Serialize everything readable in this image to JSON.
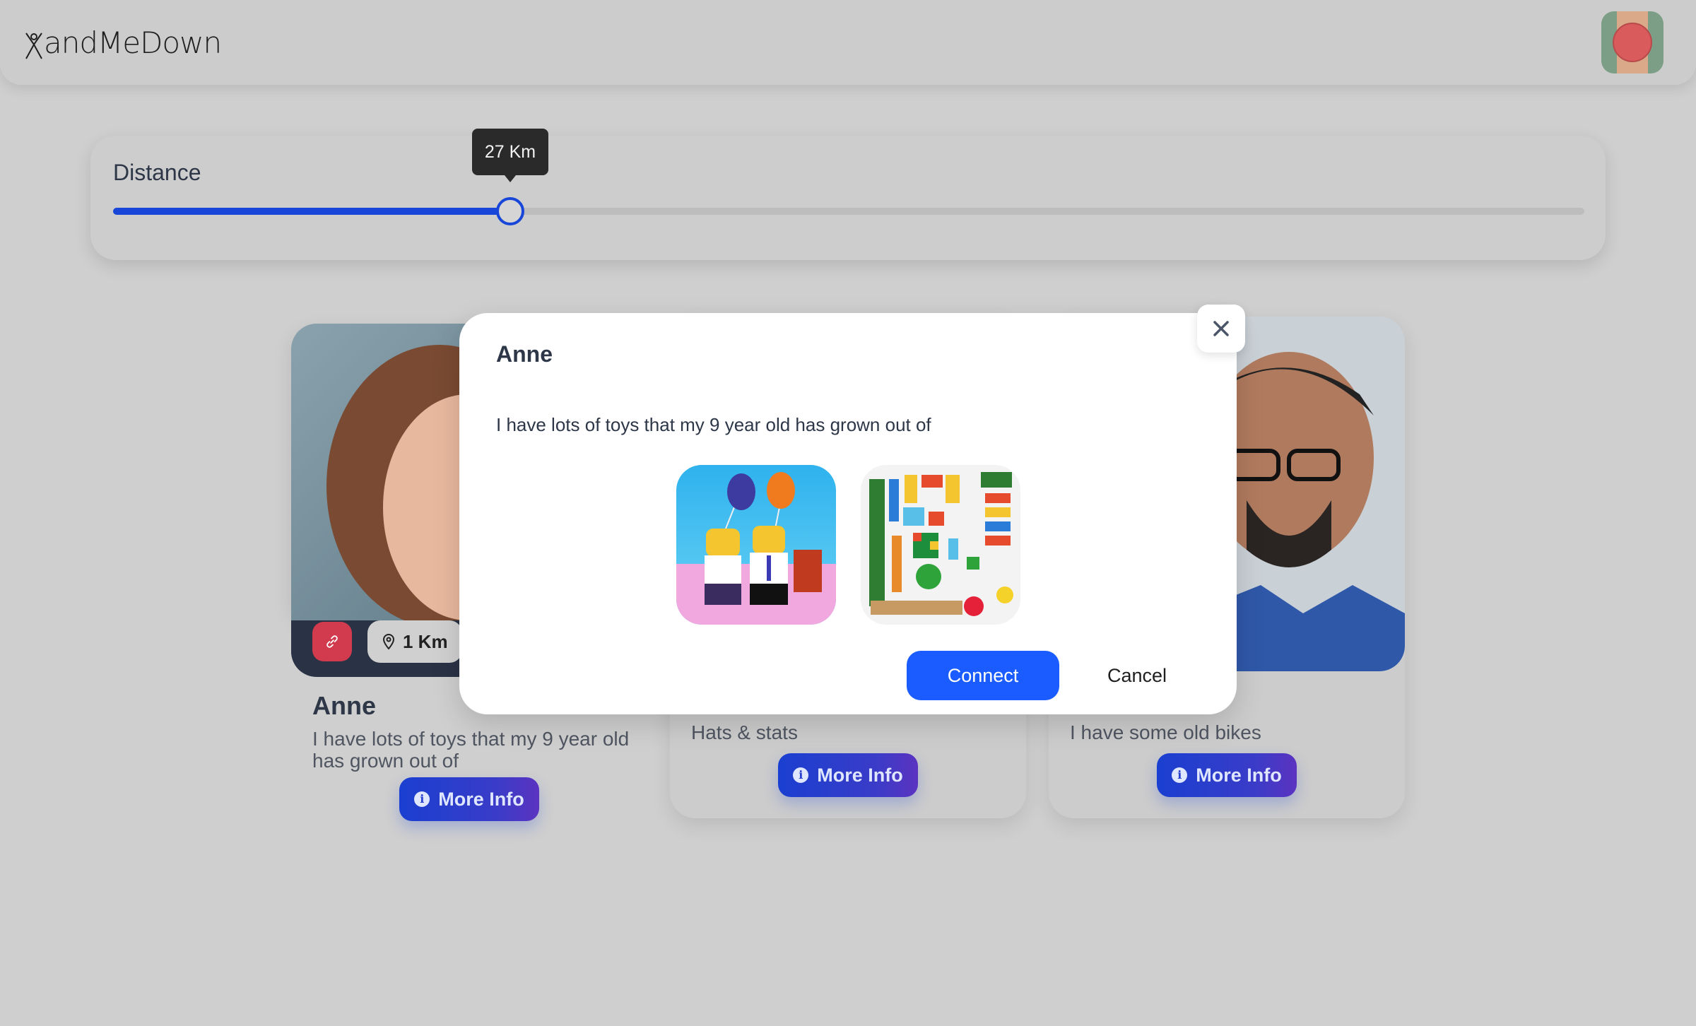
{
  "app": {
    "logo_text": "andMeDown"
  },
  "header": {
    "avatar_icon": "user-avatar"
  },
  "filter": {
    "label": "Distance",
    "value_label": "27 Km",
    "value_fraction": 0.27,
    "accent": "#1846d8"
  },
  "cards": [
    {
      "name": "Anne",
      "description": "I have lots of toys that my 9 year old has grown out of",
      "distance": "1 Km",
      "button_label": "More Info"
    },
    {
      "name": "",
      "description": "Hats & stats",
      "button_label": "More Info"
    },
    {
      "name": "",
      "description": "I have some old bikes",
      "button_label": "More Info"
    }
  ],
  "modal": {
    "title": "Anne",
    "description": "I have lots of toys that my 9 year old has grown out of",
    "images": [
      "lego-party-figures-image",
      "assorted-toys-flatlay-image"
    ],
    "connect_label": "Connect",
    "cancel_label": "Cancel"
  },
  "colors": {
    "primary": "#1a5cff",
    "badge_red": "#d23b4e",
    "background": "#cfcfcf"
  }
}
